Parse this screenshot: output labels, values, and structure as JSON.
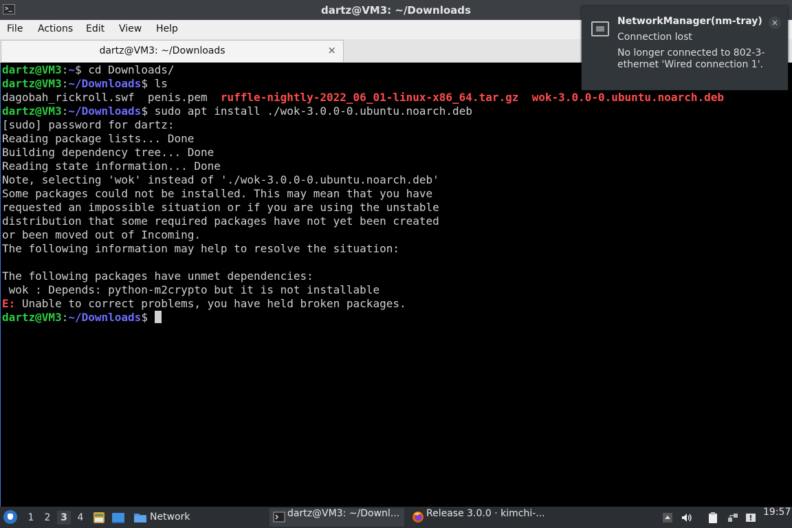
{
  "window": {
    "title": "dartz@VM3: ~/Downloads",
    "app_icon_glyph": ">_"
  },
  "menubar": {
    "items": [
      "File",
      "Actions",
      "Edit",
      "View",
      "Help"
    ]
  },
  "tabs": [
    {
      "label": "dartz@VM3: ~/Downloads",
      "close_glyph": "×"
    }
  ],
  "terminal": {
    "prompt_user": "dartz@VM3",
    "lines": [
      {
        "segments": [
          {
            "t": "dartz@VM3",
            "c": "g"
          },
          {
            "t": ":",
            "c": ""
          },
          {
            "t": "~",
            "c": "b"
          },
          {
            "t": "$ cd Downloads/",
            "c": ""
          }
        ]
      },
      {
        "segments": [
          {
            "t": "dartz@VM3",
            "c": "g"
          },
          {
            "t": ":",
            "c": ""
          },
          {
            "t": "~/Downloads",
            "c": "b"
          },
          {
            "t": "$ ls",
            "c": ""
          }
        ]
      },
      {
        "segments": [
          {
            "t": "dagobah_rickroll.swf  penis.pem  ",
            "c": ""
          },
          {
            "t": "ruffle-nightly-2022_06_01-linux-x86_64.tar.gz",
            "c": "r"
          },
          {
            "t": "  ",
            "c": ""
          },
          {
            "t": "wok-3.0.0-0.ubuntu.noarch.deb",
            "c": "r"
          }
        ]
      },
      {
        "segments": [
          {
            "t": "dartz@VM3",
            "c": "g"
          },
          {
            "t": ":",
            "c": ""
          },
          {
            "t": "~/Downloads",
            "c": "b"
          },
          {
            "t": "$ sudo apt install ./wok-3.0.0-0.ubuntu.noarch.deb",
            "c": ""
          }
        ]
      },
      {
        "segments": [
          {
            "t": "[sudo] password for dartz:",
            "c": ""
          }
        ]
      },
      {
        "segments": [
          {
            "t": "Reading package lists... Done",
            "c": ""
          }
        ]
      },
      {
        "segments": [
          {
            "t": "Building dependency tree... Done",
            "c": ""
          }
        ]
      },
      {
        "segments": [
          {
            "t": "Reading state information... Done",
            "c": ""
          }
        ]
      },
      {
        "segments": [
          {
            "t": "Note, selecting 'wok' instead of './wok-3.0.0-0.ubuntu.noarch.deb'",
            "c": ""
          }
        ]
      },
      {
        "segments": [
          {
            "t": "Some packages could not be installed. This may mean that you have",
            "c": ""
          }
        ]
      },
      {
        "segments": [
          {
            "t": "requested an impossible situation or if you are using the unstable",
            "c": ""
          }
        ]
      },
      {
        "segments": [
          {
            "t": "distribution that some required packages have not yet been created",
            "c": ""
          }
        ]
      },
      {
        "segments": [
          {
            "t": "or been moved out of Incoming.",
            "c": ""
          }
        ]
      },
      {
        "segments": [
          {
            "t": "The following information may help to resolve the situation:",
            "c": ""
          }
        ]
      },
      {
        "segments": [
          {
            "t": "",
            "c": ""
          }
        ]
      },
      {
        "segments": [
          {
            "t": "The following packages have unmet dependencies:",
            "c": ""
          }
        ]
      },
      {
        "segments": [
          {
            "t": " wok : Depends: python-m2crypto but it is not installable",
            "c": ""
          }
        ]
      },
      {
        "segments": [
          {
            "t": "E:",
            "c": "r"
          },
          {
            "t": " Unable to correct problems, you have held broken packages.",
            "c": ""
          }
        ]
      },
      {
        "segments": [
          {
            "t": "dartz@VM3",
            "c": "g"
          },
          {
            "t": ":",
            "c": ""
          },
          {
            "t": "~/Downloads",
            "c": "b"
          },
          {
            "t": "$ ",
            "c": ""
          }
        ],
        "cursor": true
      }
    ]
  },
  "notification": {
    "app_name": "NetworkManager(nm-tray)",
    "summary": "Connection lost",
    "body": "No longer connected to 802-3-ethernet 'Wired connection 1'.",
    "close_glyph": "×",
    "icon": "network-wired-icon"
  },
  "taskbar": {
    "workspaces": [
      "1",
      "2",
      "3",
      "4"
    ],
    "active_workspace": "3",
    "quicklaunch": [
      {
        "name": "file-manager-launcher-icon",
        "label": ""
      },
      {
        "name": "desktop-launcher-icon",
        "label": ""
      },
      {
        "name": "network-folder-launcher-icon",
        "label": "Network"
      }
    ],
    "tasks": [
      {
        "label": "dartz@VM3: ~/Downl...",
        "icon": "terminal-icon",
        "active": true
      },
      {
        "label": "Release 3.0.0 · kimchi-...",
        "icon": "firefox-icon",
        "active": false
      }
    ],
    "tray_icons": [
      "tray-up-arrow-icon",
      "volume-icon",
      "clipboard-icon",
      "network-disconnected-icon",
      "notification-icon"
    ],
    "clock": "19:57"
  },
  "colors": {
    "prompt_green": "#2ecc40",
    "path_blue": "#6d6dff",
    "archive_red": "#ff4d4d",
    "terminal_bg": "#000000",
    "taskbar_bg": "#2b2e33"
  }
}
